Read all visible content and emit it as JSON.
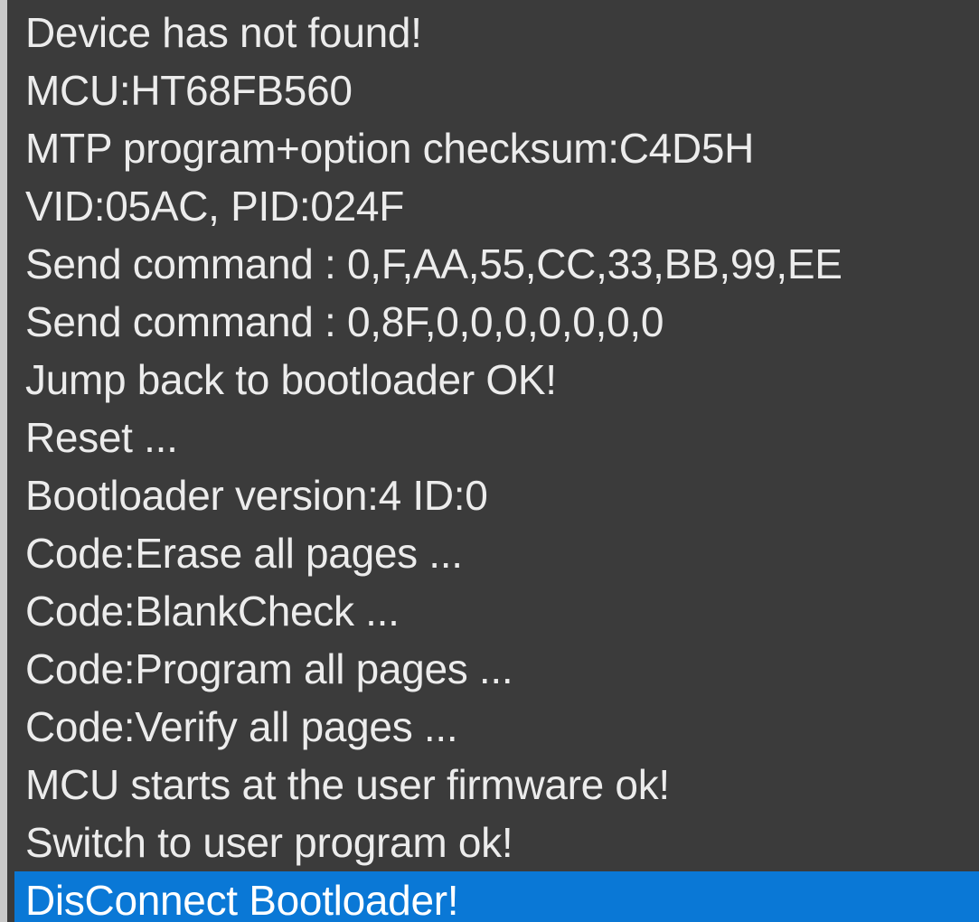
{
  "log": {
    "selected_index": 15,
    "colors": {
      "background": "#3b3b3b",
      "text": "#ececec",
      "selection": "#0a78d6",
      "selection_text": "#ffffff"
    },
    "lines": [
      "Device has not found!",
      "MCU:HT68FB560",
      "MTP program+option checksum:C4D5H",
      "VID:05AC, PID:024F",
      "Send command : 0,F,AA,55,CC,33,BB,99,EE",
      "Send command : 0,8F,0,0,0,0,0,0,0",
      "Jump back to bootloader OK!",
      "Reset ...",
      "Bootloader version:4 ID:0",
      "Code:Erase all pages ...",
      "Code:BlankCheck ...",
      "Code:Program all pages ...",
      "Code:Verify all pages ...",
      "MCU starts at the user firmware ok!",
      "Switch to user program ok!",
      "DisConnect Bootloader!"
    ]
  }
}
